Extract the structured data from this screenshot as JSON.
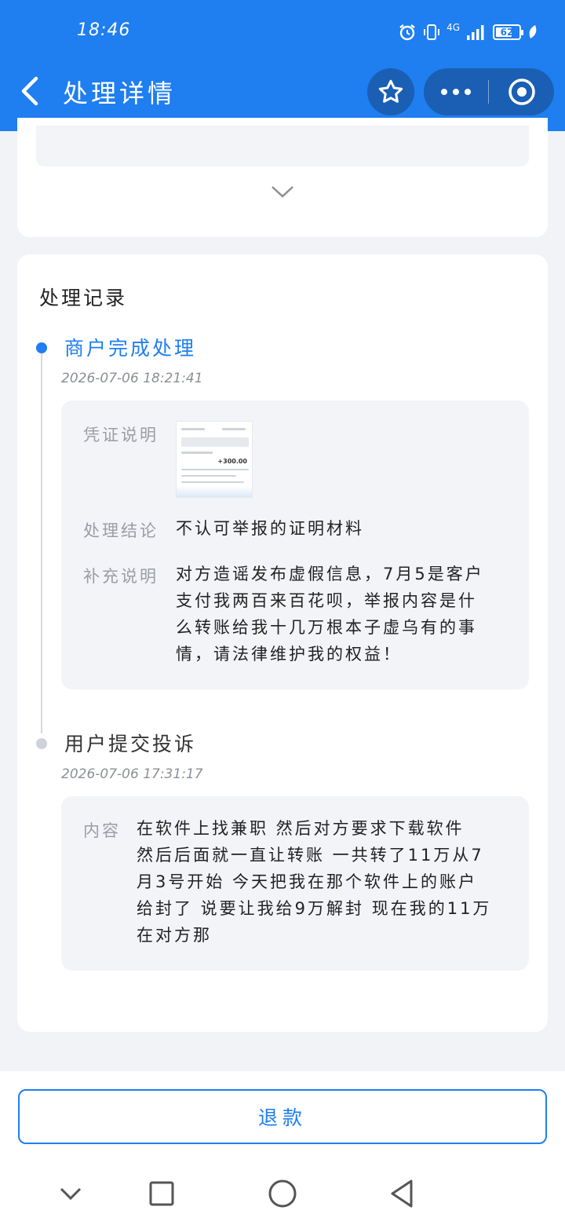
{
  "status_bar": {
    "time": "18:46",
    "network": "4G",
    "battery": "62"
  },
  "header": {
    "title": "处理详情",
    "icons": [
      "back-icon",
      "star-icon",
      "more-icon",
      "close-target-icon"
    ]
  },
  "section": {
    "title": "处理记录"
  },
  "steps": [
    {
      "title": "商户完成处理",
      "time": "2026-07-06 18:21:41",
      "status_color": "#1f7ef0",
      "evidence_label": "凭证说明",
      "conclusion_label": "处理结论",
      "conclusion": "不认可举报的证明材料",
      "supplement_label": "补充说明",
      "supplement_lines": [
        "对方造谣发布虚假信息，7月5是客户",
        "支付我两百来百花呗，举报内容是什",
        "么转账给我十几万根本子虚乌有的事",
        "情，请法律维护我的权益！"
      ],
      "thumbnail_amount": "+300.00"
    },
    {
      "title": "用户提交投诉",
      "time": "2026-07-06 17:31:17",
      "content_label": "内容",
      "content_lines": [
        "在软件上找兼职 然后对方要求下载软件",
        "然后后面就一直让转账 一共转了11万从7",
        "月3号开始 今天把我在那个软件上的账户",
        "给封了 说要让我给9万解封 现在我的11万",
        "在对方那"
      ]
    }
  ],
  "footer": {
    "refund_label": "退款"
  },
  "system_nav": [
    "chevron-down-icon",
    "recents-square-icon",
    "home-circle-icon",
    "back-triangle-icon"
  ],
  "colors": {
    "primary": "#1f7ef0",
    "header_button": "#1a5fb4",
    "background": "#f1f3f7",
    "detail_bg": "#f3f4f8"
  }
}
